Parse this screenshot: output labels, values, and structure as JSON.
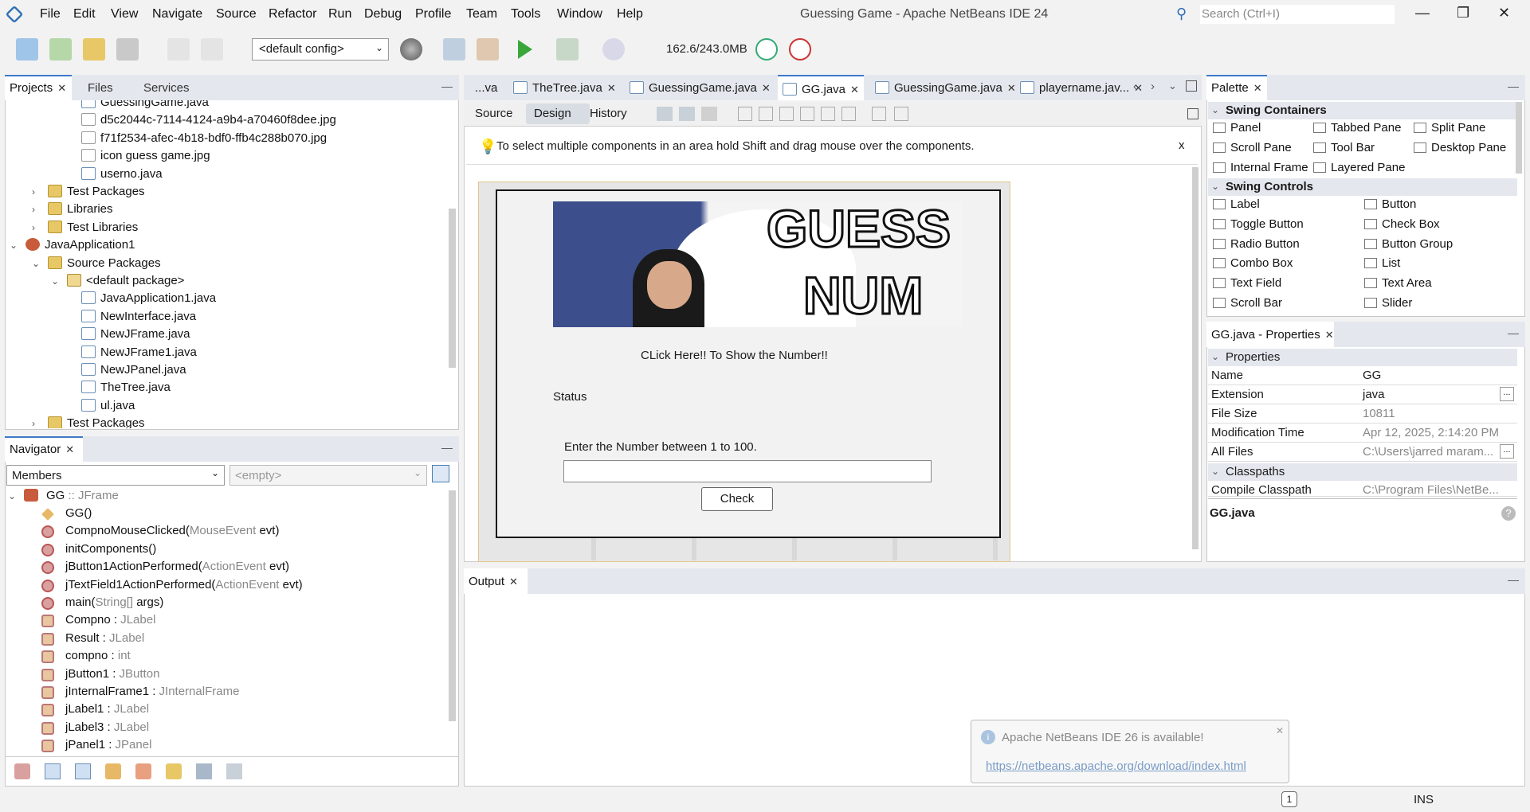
{
  "menu": [
    "File",
    "Edit",
    "View",
    "Navigate",
    "Source",
    "Refactor",
    "Run",
    "Debug",
    "Profile",
    "Team",
    "Tools",
    "Window",
    "Help"
  ],
  "window_title": "Guessing Game - Apache NetBeans IDE 24",
  "search_placeholder": "Search (Ctrl+I)",
  "toolbar": {
    "config": "<default config>",
    "memory": "162.6/243.0MB"
  },
  "projects_panel": {
    "tabs": [
      "Projects",
      "Files",
      "Services"
    ],
    "rows": [
      {
        "label": "GuessingGame.java",
        "icon": "java"
      },
      {
        "label": "d5c2044c-7114-4124-a9b4-a70460f8dee.jpg",
        "icon": "img"
      },
      {
        "label": "f71f2534-afec-4b18-bdf0-ffb4c288b070.jpg",
        "icon": "img"
      },
      {
        "label": "icon guess game.jpg",
        "icon": "img"
      },
      {
        "label": "userno.java",
        "icon": "java"
      },
      {
        "label": "Test Packages",
        "icon": "folder"
      },
      {
        "label": "Libraries",
        "icon": "folder"
      },
      {
        "label": "Test Libraries",
        "icon": "folder"
      },
      {
        "label": "JavaApplication1",
        "icon": "proj"
      },
      {
        "label": "Source Packages",
        "icon": "folder"
      },
      {
        "label": "<default package>",
        "icon": "pkg"
      },
      {
        "label": "JavaApplication1.java",
        "icon": "java"
      },
      {
        "label": "NewInterface.java",
        "icon": "java"
      },
      {
        "label": "NewJFrame.java",
        "icon": "java"
      },
      {
        "label": "NewJFrame1.java",
        "icon": "java"
      },
      {
        "label": "NewJPanel.java",
        "icon": "java"
      },
      {
        "label": "TheTree.java",
        "icon": "java"
      },
      {
        "label": "ul.java",
        "icon": "java"
      },
      {
        "label": "Test Packages",
        "icon": "folder"
      }
    ]
  },
  "navigator": {
    "title": "Navigator",
    "members_select": "Members",
    "filter_select": "<empty>",
    "root": {
      "name": "GG",
      "type": " :: JFrame"
    },
    "rows": [
      {
        "name": "GG()",
        "type": ""
      },
      {
        "name": "CompnoMouseClicked(",
        "type": "MouseEvent",
        "tail": " evt)"
      },
      {
        "name": "initComponents()",
        "type": ""
      },
      {
        "name": "jButton1ActionPerformed(",
        "type": "ActionEvent",
        "tail": " evt)"
      },
      {
        "name": "jTextField1ActionPerformed(",
        "type": "ActionEvent",
        "tail": " evt)"
      },
      {
        "name": "main(",
        "type": "String[]",
        "tail": " args)"
      },
      {
        "name": "Compno : ",
        "type": "JLabel"
      },
      {
        "name": "Result : ",
        "type": "JLabel"
      },
      {
        "name": "compno : ",
        "type": "int"
      },
      {
        "name": "jButton1 : ",
        "type": "JButton"
      },
      {
        "name": "jInternalFrame1 : ",
        "type": "JInternalFrame"
      },
      {
        "name": "jLabel1 : ",
        "type": "JLabel"
      },
      {
        "name": "jLabel3 : ",
        "type": "JLabel"
      },
      {
        "name": "jPanel1 : ",
        "type": "JPanel"
      }
    ]
  },
  "editor": {
    "tabs": [
      "...va",
      "TheTree.java",
      "GuessingGame.java",
      "GG.java",
      "GuessingGame.java",
      "playername.jav..."
    ],
    "active_tab": 3,
    "views": [
      "Source",
      "Design",
      "History"
    ],
    "hint": "To select multiple components in an area hold Shift and drag mouse over the components.",
    "hint_close": "x",
    "form": {
      "banner_text_1": "GUESS",
      "banner_text_2": "NUM",
      "show_label": "CLick Here!! To Show the Number!!",
      "status_label": "Status",
      "prompt": "Enter the Number between 1 to 100.",
      "check_button": "Check"
    }
  },
  "output": {
    "title": "Output"
  },
  "palette": {
    "title": "Palette",
    "containers_head": "Swing Containers",
    "containers": [
      "Panel",
      "Tabbed Pane",
      "Split Pane",
      "Scroll Pane",
      "Tool Bar",
      "Desktop Pane",
      "Internal Frame",
      "Layered Pane"
    ],
    "controls_head": "Swing Controls",
    "controls": [
      "Label",
      "Button",
      "Toggle Button",
      "Check Box",
      "Radio Button",
      "Button Group",
      "Combo Box",
      "List",
      "Text Field",
      "Text Area",
      "Scroll Bar",
      "Slider"
    ]
  },
  "properties": {
    "title": "GG.java - Properties",
    "section": "Properties",
    "rows": [
      {
        "name": "Name",
        "value": "GG"
      },
      {
        "name": "Extension",
        "value": "java"
      },
      {
        "name": "File Size",
        "value": "10811"
      },
      {
        "name": "Modification Time",
        "value": "Apr 12, 2025, 2:14:20 PM"
      },
      {
        "name": "All Files",
        "value": "C:\\Users\\jarred maram..."
      }
    ],
    "classpaths": "Classpaths",
    "compile_row": {
      "name": "Compile Classpath",
      "value": "C:\\Program Files\\NetBe..."
    },
    "footer": "GG.java"
  },
  "notification": {
    "title": "Apache NetBeans IDE 26 is available!",
    "link": "https://netbeans.apache.org/download/index.html"
  },
  "status": {
    "insert_mode": "INS",
    "notif_count": "1"
  }
}
